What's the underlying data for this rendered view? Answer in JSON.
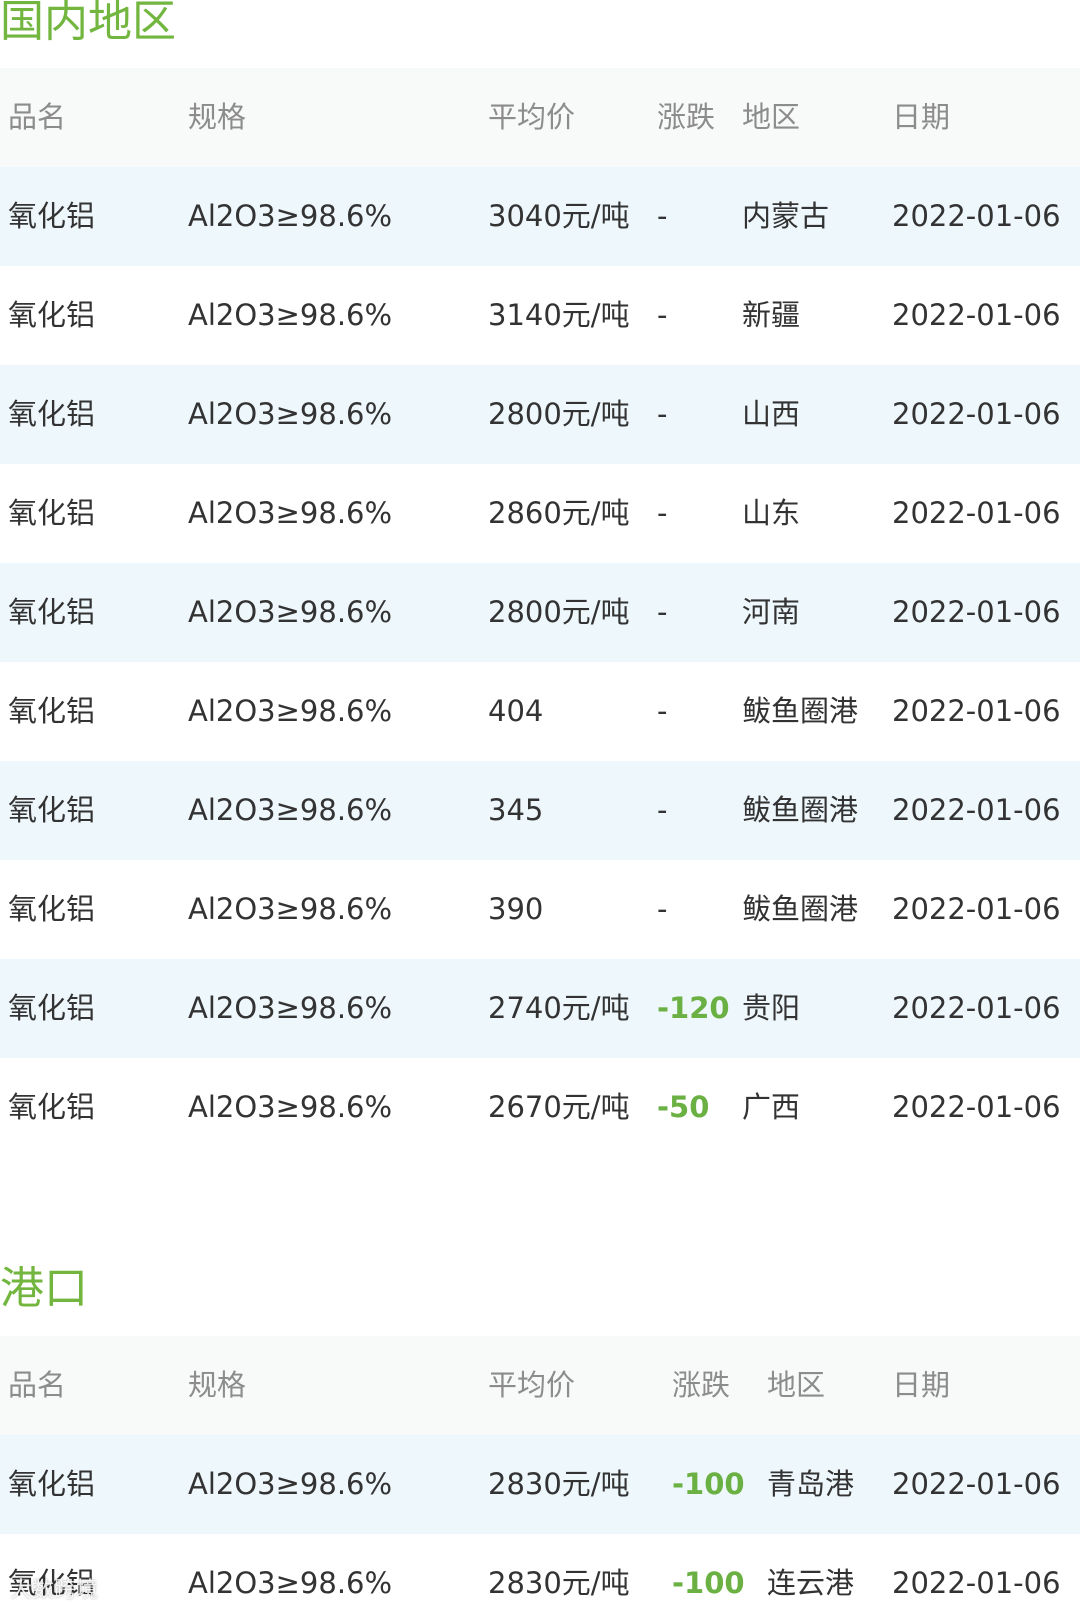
{
  "sections": [
    {
      "title": "国内地区",
      "headers": {
        "name": "品名",
        "spec": "规格",
        "price": "平均价",
        "change": "涨跌",
        "region": "地区",
        "date": "日期"
      },
      "rows": [
        {
          "name": "氧化铝",
          "spec": "Al2O3≥98.6%",
          "price": "3040元/吨",
          "change": "-",
          "region": "内蒙古",
          "date": "2022-01-06"
        },
        {
          "name": "氧化铝",
          "spec": "Al2O3≥98.6%",
          "price": "3140元/吨",
          "change": "-",
          "region": "新疆",
          "date": "2022-01-06"
        },
        {
          "name": "氧化铝",
          "spec": "Al2O3≥98.6%",
          "price": "2800元/吨",
          "change": "-",
          "region": "山西",
          "date": "2022-01-06"
        },
        {
          "name": "氧化铝",
          "spec": "Al2O3≥98.6%",
          "price": "2860元/吨",
          "change": "-",
          "region": "山东",
          "date": "2022-01-06"
        },
        {
          "name": "氧化铝",
          "spec": "Al2O3≥98.6%",
          "price": "2800元/吨",
          "change": "-",
          "region": "河南",
          "date": "2022-01-06"
        },
        {
          "name": "氧化铝",
          "spec": "Al2O3≥98.6%",
          "price": "404",
          "change": "-",
          "region": "鲅鱼圈港",
          "date": "2022-01-06"
        },
        {
          "name": "氧化铝",
          "spec": "Al2O3≥98.6%",
          "price": "345",
          "change": "-",
          "region": "鲅鱼圈港",
          "date": "2022-01-06"
        },
        {
          "name": "氧化铝",
          "spec": "Al2O3≥98.6%",
          "price": "390",
          "change": "-",
          "region": "鲅鱼圈港",
          "date": "2022-01-06"
        },
        {
          "name": "氧化铝",
          "spec": "Al2O3≥98.6%",
          "price": "2740元/吨",
          "change": "-120",
          "region": "贵阳",
          "date": "2022-01-06"
        },
        {
          "name": "氧化铝",
          "spec": "Al2O3≥98.6%",
          "price": "2670元/吨",
          "change": "-50",
          "region": "广西",
          "date": "2022-01-06"
        }
      ]
    },
    {
      "title": "港口",
      "headers": {
        "name": "品名",
        "spec": "规格",
        "price": "平均价",
        "change": "涨跌",
        "region": "地区",
        "date": "日期"
      },
      "rows": [
        {
          "name": "氧化铝",
          "spec": "Al2O3≥98.6%",
          "price": "2830元/吨",
          "change": "-100",
          "region": "青岛港",
          "date": "2022-01-06"
        },
        {
          "name": "氧化铝",
          "spec": "Al2O3≥98.6%",
          "price": "2830元/吨",
          "change": "-100",
          "region": "连云港",
          "date": "2022-01-06"
        }
      ]
    }
  ],
  "watermark": "大数跨境",
  "colors": {
    "section_title": "#72b63f",
    "change_down": "#6ab043",
    "header_row_bg": "#f8f9f9",
    "alt_row_bg": "#eef7fc",
    "text": "#333333",
    "header_text": "#8c8c8c"
  }
}
